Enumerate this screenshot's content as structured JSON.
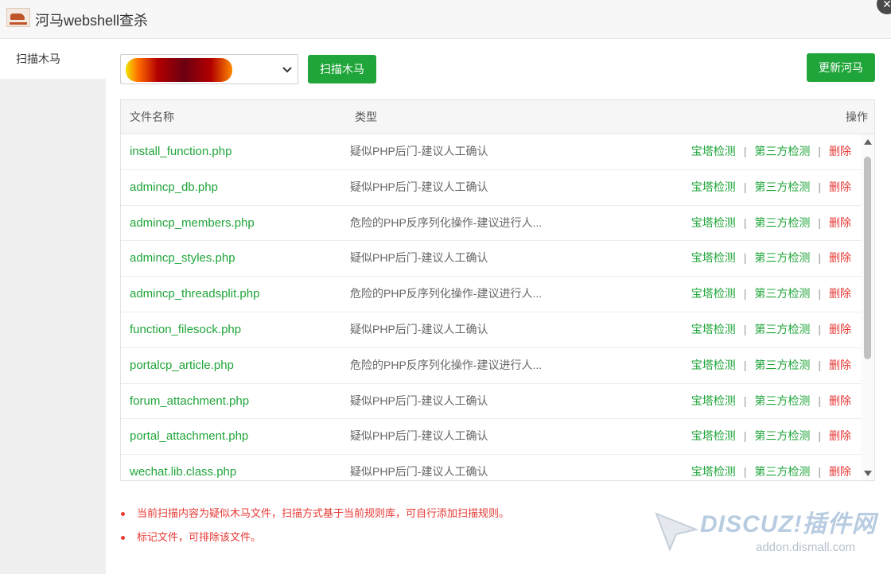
{
  "window": {
    "title": "河马webshell查杀",
    "logo_icon": "hippo-logo-icon",
    "close_icon": "close-icon"
  },
  "sidebar": {
    "items": [
      {
        "label": "扫描木马"
      }
    ]
  },
  "toolbar": {
    "select_value": "",
    "scan_button": "扫描木马",
    "update_button": "更新河马",
    "accent_color": "#20a53a"
  },
  "table": {
    "headers": {
      "name": "文件名称",
      "type": "类型",
      "ops": "操作"
    },
    "rows": [
      {
        "name": "install_function.php",
        "type": "疑似PHP后门-建议人工确认"
      },
      {
        "name": "admincp_db.php",
        "type": "疑似PHP后门-建议人工确认"
      },
      {
        "name": "admincp_members.php",
        "type": "危险的PHP反序列化操作-建议进行人..."
      },
      {
        "name": "admincp_styles.php",
        "type": "疑似PHP后门-建议人工确认"
      },
      {
        "name": "admincp_threadsplit.php",
        "type": "危险的PHP反序列化操作-建议进行人..."
      },
      {
        "name": "function_filesock.php",
        "type": "疑似PHP后门-建议人工确认"
      },
      {
        "name": "portalcp_article.php",
        "type": "危险的PHP反序列化操作-建议进行人..."
      },
      {
        "name": "forum_attachment.php",
        "type": "疑似PHP后门-建议人工确认"
      },
      {
        "name": "portal_attachment.php",
        "type": "疑似PHP后门-建议人工确认"
      },
      {
        "name": "wechat.lib.class.php",
        "type": "疑似PHP后门-建议人工确认"
      }
    ],
    "ops": {
      "bt_check": "宝塔检测",
      "third_check": "第三方检测",
      "delete": "删除",
      "separator": "|"
    }
  },
  "notes": [
    "当前扫描内容为疑似木马文件，扫描方式基于当前规则库，可自行添加扫描规则。",
    "标记文件，可排除该文件。"
  ],
  "watermark": {
    "text": "DISCUZ!插件网",
    "sub": "addon.dismall.com"
  }
}
